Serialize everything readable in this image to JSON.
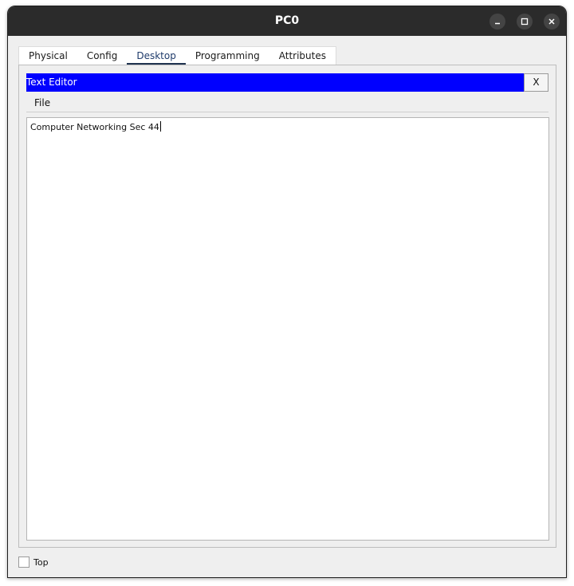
{
  "window": {
    "title": "PC0"
  },
  "tabs": [
    {
      "label": "Physical"
    },
    {
      "label": "Config"
    },
    {
      "label": "Desktop",
      "active": true
    },
    {
      "label": "Programming"
    },
    {
      "label": "Attributes"
    }
  ],
  "app": {
    "title": "Text Editor",
    "close_label": "X",
    "header_color": "#0000ff",
    "menu": [
      {
        "label": "File"
      }
    ],
    "editor_text": "Computer Networking Sec 44"
  },
  "footer": {
    "top_checkbox_label": "Top",
    "top_checked": false
  },
  "icons": {
    "minimize": "minimize-icon",
    "maximize": "maximize-icon",
    "close": "close-icon"
  }
}
